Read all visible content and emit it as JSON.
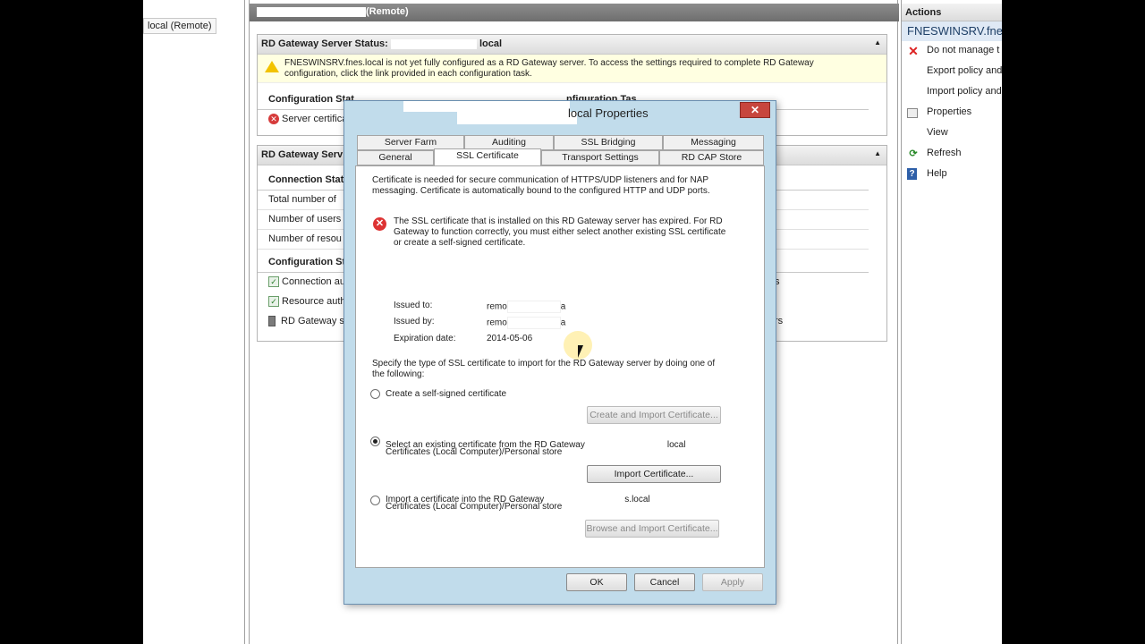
{
  "tree": {
    "item": "local (Remote)"
  },
  "center": {
    "header": "(Remote)",
    "status_panel": {
      "title_prefix": "RD Gateway Server Status:",
      "title_suffix": "local",
      "warning_line1": "FNESWINSRV.fnes.local is not yet fully configured as a RD Gateway server. To access the settings required to complete RD Gateway",
      "warning_line2": "configuration, click the link provided in each configuration task.",
      "config_status_label": "Configuration Stat",
      "config_tasks_label": "nfiguration Tas",
      "server_cert_label": "Server certifica"
    },
    "gw_panel": {
      "title": "RD Gateway Serv",
      "connection_status": "Connection Stat",
      "total": "Total number of",
      "users": "Number of users",
      "resources": "Number of resou",
      "config_status": "Configuration St",
      "connection_auth": "Connection au",
      "resource_auth": "Resource auth",
      "rd_gateway": "RD Gateway s",
      "right_1": "s",
      "right_2": "rs"
    }
  },
  "actions": {
    "header": "Actions",
    "node": "FNESWINSRV.fnes",
    "items": [
      {
        "label": "Do not manage t",
        "icon": "red-x-icon"
      },
      {
        "label": "Export policy and",
        "icon": ""
      },
      {
        "label": "Import policy and",
        "icon": ""
      },
      {
        "label": "Properties",
        "icon": "properties-icon"
      },
      {
        "label": "View",
        "icon": ""
      },
      {
        "label": "Refresh",
        "icon": "refresh-icon"
      },
      {
        "label": "Help",
        "icon": "help-icon"
      }
    ]
  },
  "dialog": {
    "title": "local Properties",
    "close": "✕",
    "tabs_top": [
      "Server Farm",
      "Auditing",
      "SSL Bridging",
      "Messaging"
    ],
    "tabs_bottom": [
      "General",
      "SSL Certificate",
      "Transport Settings",
      "RD CAP Store"
    ],
    "intro_line1": "Certificate is needed for secure communication of HTTPS/UDP listeners and for NAP",
    "intro_line2": "messaging. Certificate is automatically bound to the configured HTTP and UDP ports.",
    "error_line1": "The SSL certificate that is installed on this RD Gateway server has expired. For RD",
    "error_line2": "Gateway to function correctly, you must either select another existing SSL certificate",
    "error_line3": "or create a self-signed certificate.",
    "issued_to_label": "Issued to:",
    "issued_to_value": "remo",
    "issued_to_tail": "a",
    "issued_by_label": "Issued by:",
    "issued_by_value": "remo",
    "issued_by_tail": "a",
    "expiration_label": "Expiration date:",
    "expiration_value": "2014-05-06",
    "specify_line1": "Specify the type of SSL certificate to import for the RD Gateway server by doing one of",
    "specify_line2": "the following:",
    "opt1": "Create a self-signed certificate",
    "opt1_button": "Create and Import Certificate...",
    "opt2_line1_prefix": "Select an existing certificate from the RD Gateway",
    "opt2_line1_suffix": "local",
    "opt2_line2": "Certificates (Local Computer)/Personal store",
    "opt2_button": "Import Certificate...",
    "opt3_line1_prefix": "Import a certificate into the RD Gateway",
    "opt3_line1_suffix": "s.local",
    "opt3_line2": "Certificates (Local Computer)/Personal store",
    "opt3_button": "Browse and Import Certificate...",
    "ok": "OK",
    "cancel": "Cancel",
    "apply": "Apply"
  }
}
